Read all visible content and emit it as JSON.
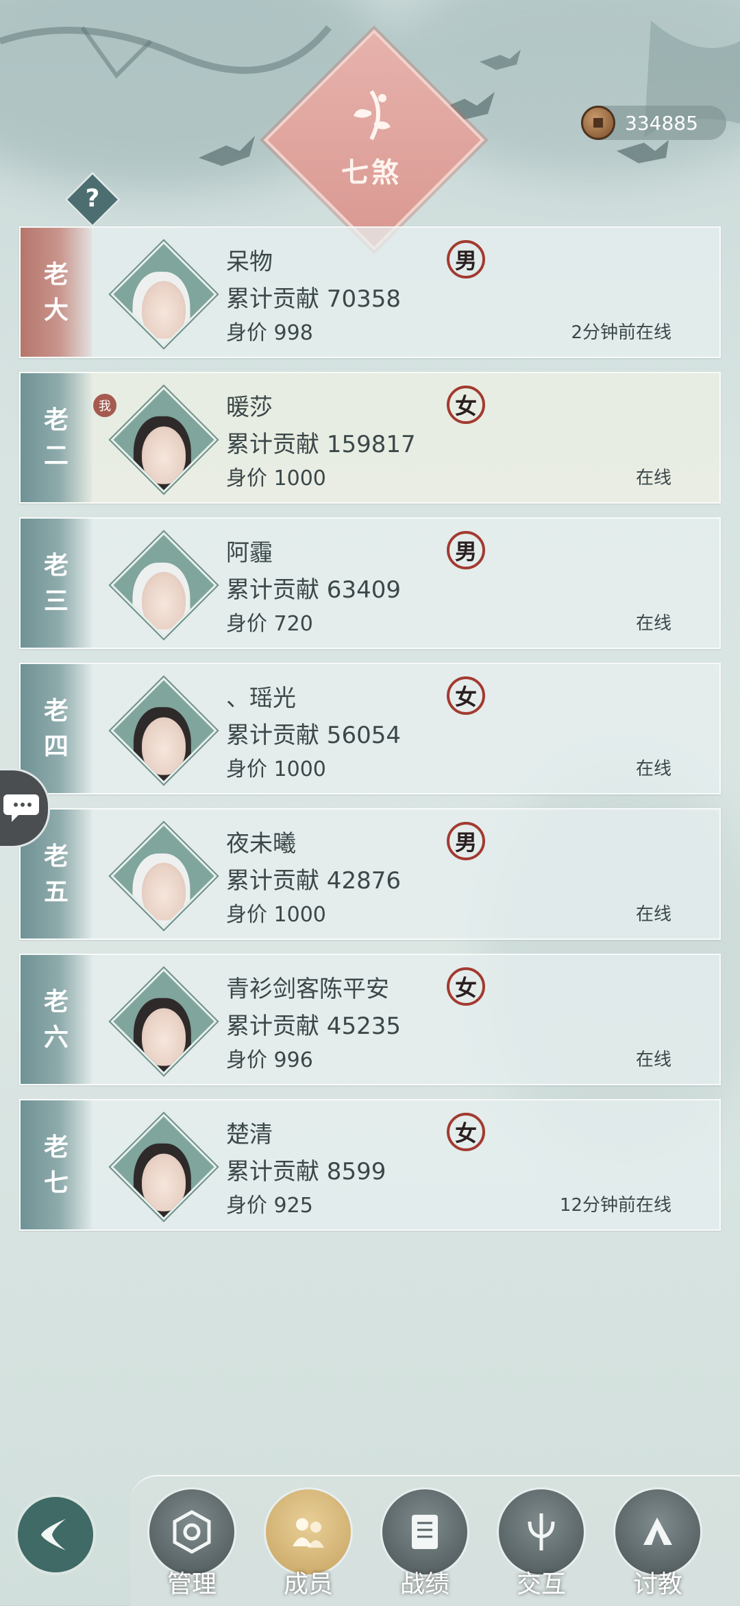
{
  "header": {
    "emblem_text": "七煞",
    "help_label": "?",
    "coins": "334885"
  },
  "members": [
    {
      "rank": [
        "老",
        "大"
      ],
      "name": "呆物",
      "contribution": "累计贡献 70358",
      "worth": "身价 998",
      "gender": "男",
      "status": "2分钟前在线",
      "hair": "white"
    },
    {
      "rank": [
        "老",
        "二"
      ],
      "name": "暖莎",
      "contribution": "累计贡献 159817",
      "worth": "身价 1000",
      "gender": "女",
      "status": "在线",
      "hair": "dark",
      "self_tag": "我"
    },
    {
      "rank": [
        "老",
        "三"
      ],
      "name": "阿霾",
      "contribution": "累计贡献 63409",
      "worth": "身价 720",
      "gender": "男",
      "status": "在线",
      "hair": "white"
    },
    {
      "rank": [
        "老",
        "四"
      ],
      "name": "、瑶光",
      "contribution": "累计贡献 56054",
      "worth": "身价 1000",
      "gender": "女",
      "status": "在线",
      "hair": "dark"
    },
    {
      "rank": [
        "老",
        "五"
      ],
      "name": "夜未曦",
      "contribution": "累计贡献 42876",
      "worth": "身价 1000",
      "gender": "男",
      "status": "在线",
      "hair": "white"
    },
    {
      "rank": [
        "老",
        "六"
      ],
      "name": "青衫剑客陈平安",
      "contribution": "累计贡献 45235",
      "worth": "身价 996",
      "gender": "女",
      "status": "在线",
      "hair": "dark"
    },
    {
      "rank": [
        "老",
        "七"
      ],
      "name": "楚清",
      "contribution": "累计贡献 8599",
      "worth": "身价 925",
      "gender": "女",
      "status": "12分钟前在线",
      "hair": "dark"
    }
  ],
  "nav": {
    "items": [
      {
        "label": "管理",
        "icon": "manage-icon"
      },
      {
        "label": "成员",
        "icon": "members-icon",
        "active": true
      },
      {
        "label": "战绩",
        "icon": "record-icon"
      },
      {
        "label": "交互",
        "icon": "interact-icon"
      },
      {
        "label": "讨教",
        "icon": "challenge-icon"
      }
    ]
  },
  "colors": {
    "boss_rank": "#b5766b",
    "rank": "#6f9294",
    "gender_ring": "#a33a30",
    "active_nav": "#c7a462"
  }
}
